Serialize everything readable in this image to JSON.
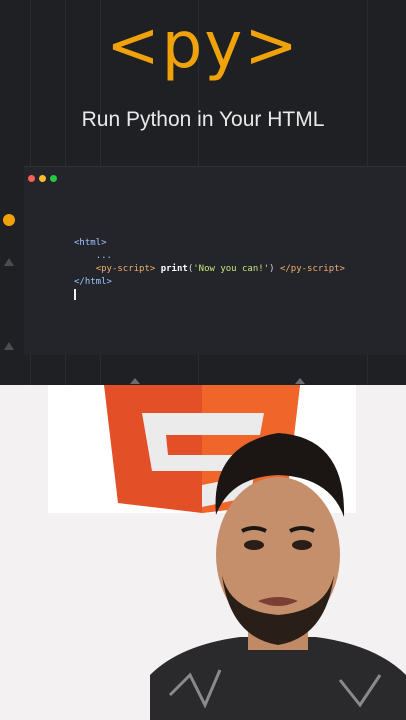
{
  "header": {
    "logo_text": "<py>",
    "subtitle": "Run Python in Your HTML"
  },
  "code_window": {
    "lines": {
      "l1": "<html>",
      "l2": "...",
      "l3_open": "<py-script>",
      "l3_fn": "print",
      "l3_paren_open": "(",
      "l3_str": "'Now you can!'",
      "l3_paren_close": ")",
      "l3_close": "</py-script>",
      "l4": "</html>"
    },
    "dots": [
      "#ff5f56",
      "#ffbd2e",
      "#27c93f"
    ]
  },
  "colors": {
    "accent": "#f0a20a",
    "html5_red": "#e34f26"
  },
  "icons": {
    "window_controls": "traffic-light-dots",
    "logo": "html5-shield-icon"
  }
}
